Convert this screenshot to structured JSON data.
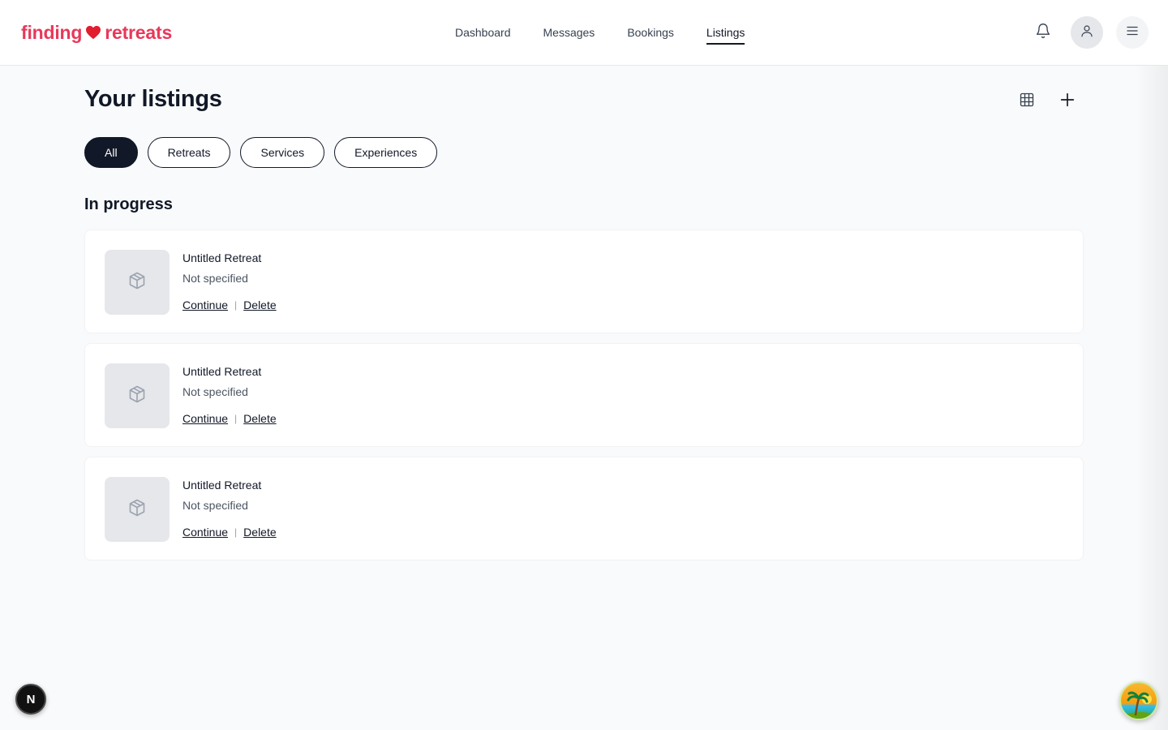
{
  "header": {
    "logo_left": "finding",
    "logo_right": "retreats",
    "nav": [
      {
        "label": "Dashboard",
        "active": false
      },
      {
        "label": "Messages",
        "active": false
      },
      {
        "label": "Bookings",
        "active": false
      },
      {
        "label": "Listings",
        "active": true
      }
    ],
    "icons": [
      "bell-icon",
      "user-icon",
      "menu-icon"
    ]
  },
  "page": {
    "title": "Your listings",
    "tools": [
      "grid-icon",
      "plus-icon"
    ]
  },
  "filters": [
    {
      "label": "All",
      "active": true
    },
    {
      "label": "Retreats",
      "active": false
    },
    {
      "label": "Services",
      "active": false
    },
    {
      "label": "Experiences",
      "active": false
    }
  ],
  "section": {
    "title": "In progress"
  },
  "listings": [
    {
      "title": "Untitled Retreat",
      "subtitle": "Not specified",
      "continue": "Continue",
      "delete": "Delete"
    },
    {
      "title": "Untitled Retreat",
      "subtitle": "Not specified",
      "continue": "Continue",
      "delete": "Delete"
    },
    {
      "title": "Untitled Retreat",
      "subtitle": "Not specified",
      "continue": "Continue",
      "delete": "Delete"
    }
  ],
  "badges": {
    "dev_badge": "N"
  },
  "colors": {
    "brand": "#e8385a",
    "primary": "#111827",
    "thumb_bg": "#e5e7eb"
  }
}
